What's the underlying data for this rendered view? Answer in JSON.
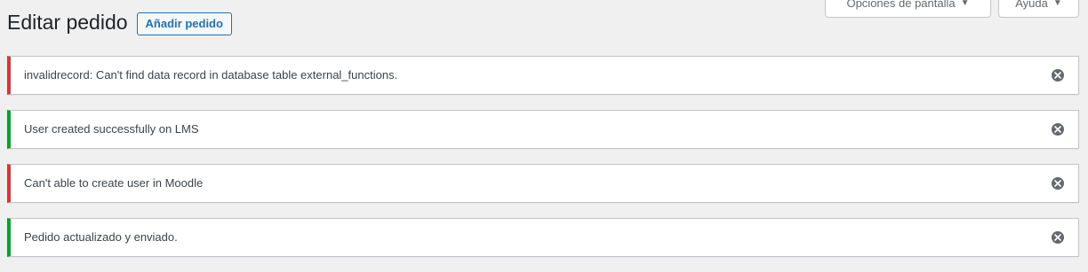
{
  "header": {
    "title": "Editar pedido",
    "add_button_label": "Añadir pedido"
  },
  "screen_meta": {
    "screen_options_label": "Opciones de pantalla",
    "help_label": "Ayuda",
    "arrow_glyph": "▼"
  },
  "notices": [
    {
      "type": "error",
      "text": "invalidrecord: Can't find data record in database table external_functions."
    },
    {
      "type": "success",
      "text": "User created successfully on LMS"
    },
    {
      "type": "error",
      "text": "Can't able to create user in Moodle"
    },
    {
      "type": "success",
      "text": "Pedido actualizado y enviado."
    }
  ],
  "colors": {
    "error": "#d63638",
    "success": "#00a32a",
    "accent": "#2271b1",
    "background": "#f0f0f1"
  },
  "icons": {
    "dismiss": "dismiss-circle-x-icon",
    "dropdown": "caret-down-icon"
  }
}
